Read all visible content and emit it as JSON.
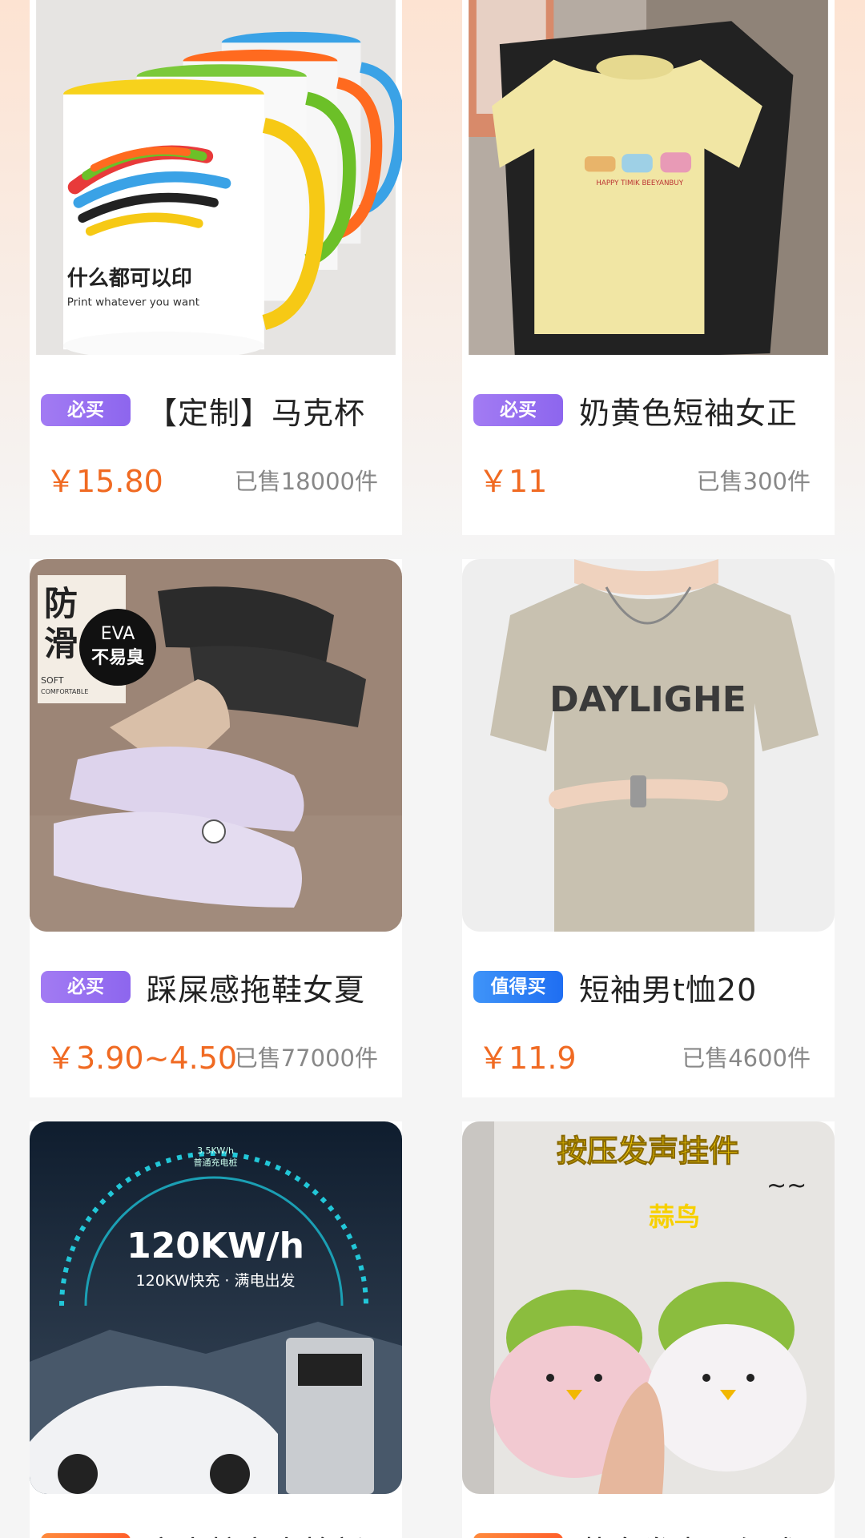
{
  "products": [
    {
      "badge": "必买",
      "title": "【定制】马克杯",
      "price": "￥15.80",
      "sold": "已售18000件"
    },
    {
      "badge": "必买",
      "title": "奶黄色短袖女正",
      "price": "￥11",
      "sold": "已售300件"
    },
    {
      "badge": "必买",
      "title": "踩屎感拖鞋女夏",
      "price": "￥3.90~4.50",
      "sold": "已售77000件"
    },
    {
      "badge": "值得买",
      "title": "短袖男t恤20",
      "price": "￥11.9",
      "sold": "已售4600件"
    },
    {
      "badge": "热点",
      "title": "充电桩充电枪新",
      "price": "",
      "sold": ""
    },
    {
      "badge": "热点",
      "title": "蒜鸟发声玩偶武",
      "price": "",
      "sold": ""
    }
  ],
  "image_text": {
    "mug_slogan": "什么都可以印",
    "mug_slogan_en": "Print whatever you want",
    "slipper_tag1": "防",
    "slipper_tag2": "滑",
    "slipper_soft": "SOFT",
    "slipper_comfortable": "COMFORTABLE",
    "slipper_eva": "EVA",
    "slipper_odor": "不易臭",
    "tshirt_print": "DAYLIGHE",
    "charger_power": "120KW/h",
    "charger_caption": "120KW快充 · 满电出发",
    "charger_top": "3.5KW/h",
    "charger_top2": "普通充电桩",
    "toy_title": "按压发声挂件",
    "toy_name": "蒜鸟",
    "toy_wave": "~~"
  },
  "colors": {
    "price": "#f06a22",
    "badge_purple": "#9a72f1",
    "badge_blue": "#2b7ff5",
    "badge_orange": "#ff6a2e"
  }
}
